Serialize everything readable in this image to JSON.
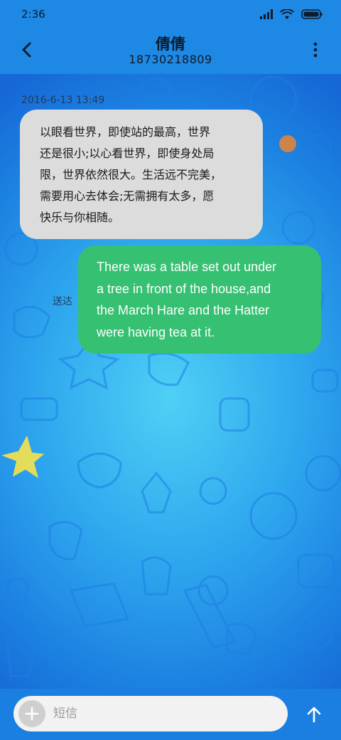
{
  "status_bar": {
    "time": "2:36",
    "icons": [
      "signal-icon",
      "wifi-icon",
      "battery-icon"
    ]
  },
  "header": {
    "contact_name": "倩倩",
    "contact_number": "18730218809",
    "back_icon": "chevron-left-icon",
    "more_icon": "more-vertical-icon"
  },
  "conversation": {
    "timestamp": "2016-6-13 13:49",
    "received_message": {
      "lines": [
        "以眼看世界，即使站的最高，世界",
        "还是很小;以心看世界，即使身处局",
        "限，世界依然很大。生活远不完美，",
        "需要用心去体会;无需拥有太多，愿",
        "快乐与你相随。"
      ]
    },
    "sent_message": {
      "lines": [
        "There was a table set out under",
        "a tree in front of the house,and",
        "the March Hare and the Hatter",
        "were having tea at it."
      ],
      "status": "送达"
    }
  },
  "composer": {
    "add_icon": "plus-icon",
    "placeholder": "短信",
    "value": "",
    "send_icon": "arrow-up-icon"
  },
  "colors": {
    "header_bg": "#1e88e5",
    "received_bubble": "#dcdcdc",
    "sent_bubble": "#36c072",
    "composer_bg": "#f2f2f2"
  }
}
